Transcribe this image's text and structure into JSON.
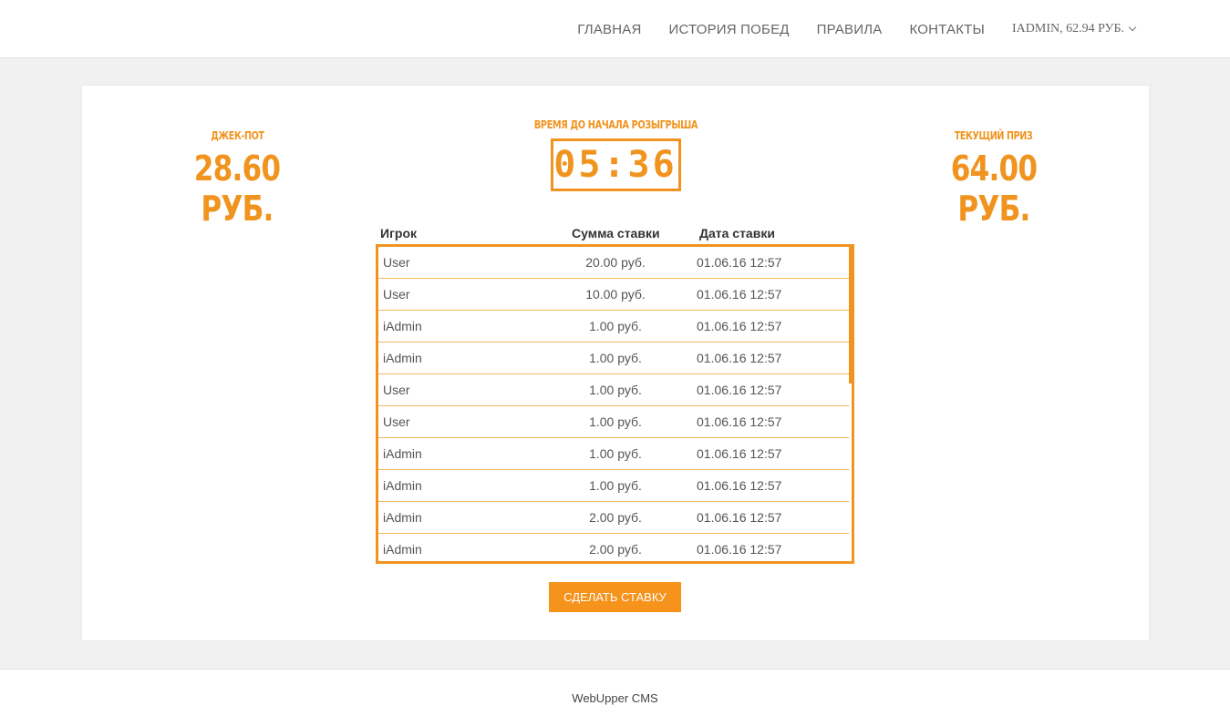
{
  "nav": {
    "items": [
      "ГЛАВНАЯ",
      "ИСТОРИЯ ПОБЕД",
      "ПРАВИЛА",
      "КОНТАКТЫ"
    ],
    "user": "IADMIN, 62.94 РУБ."
  },
  "jackpot": {
    "label": "ДЖЕК-ПОТ",
    "value": "28.60 РУБ."
  },
  "timer": {
    "label": "ВРЕМЯ ДО НАЧАЛА РОЗЫГРЫША",
    "value": "05:36"
  },
  "prize": {
    "label": "ТЕКУЩИЙ ПРИЗ",
    "value": "64.00 РУБ."
  },
  "table": {
    "headers": [
      "Игрок",
      "Сумма ставки",
      "Дата ставки"
    ],
    "rows": [
      [
        "User",
        "20.00 руб.",
        "01.06.16 12:57"
      ],
      [
        "User",
        "10.00 руб.",
        "01.06.16 12:57"
      ],
      [
        "iAdmin",
        "1.00 руб.",
        "01.06.16 12:57"
      ],
      [
        "iAdmin",
        "1.00 руб.",
        "01.06.16 12:57"
      ],
      [
        "User",
        "1.00 руб.",
        "01.06.16 12:57"
      ],
      [
        "User",
        "1.00 руб.",
        "01.06.16 12:57"
      ],
      [
        "iAdmin",
        "1.00 руб.",
        "01.06.16 12:57"
      ],
      [
        "iAdmin",
        "1.00 руб.",
        "01.06.16 12:57"
      ],
      [
        "iAdmin",
        "2.00 руб.",
        "01.06.16 12:57"
      ],
      [
        "iAdmin",
        "2.00 руб.",
        "01.06.16 12:57"
      ]
    ]
  },
  "bet_button": "СДЕЛАТЬ СТАВКУ",
  "footer": "WebUpper CMS",
  "colors": {
    "accent": "#f0941f",
    "button": "#f5931c"
  }
}
